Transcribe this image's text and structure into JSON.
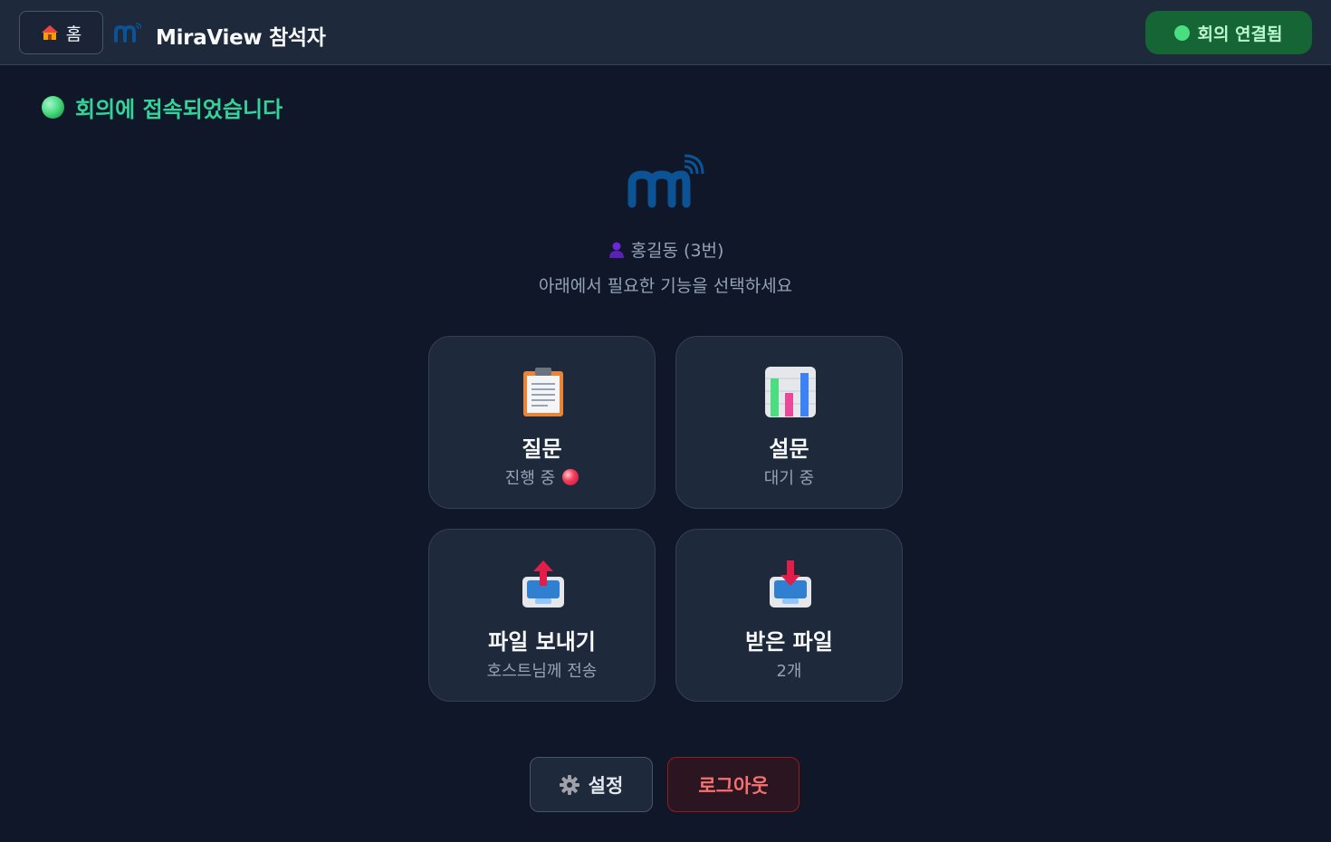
{
  "header": {
    "home_label": "홈",
    "app_title": "MiraView 참석자",
    "status_label": "회의 연결됨"
  },
  "connection": {
    "message": "회의에 접속되었습니다"
  },
  "user": {
    "name": "홍길동 (3번)",
    "instruction": "아래에서 필요한 기능을 선택하세요"
  },
  "cards": [
    {
      "icon": "clipboard-icon",
      "title": "질문",
      "subtitle": "진행 중",
      "indicator": "red-dot-icon"
    },
    {
      "icon": "bar-chart-icon",
      "title": "설문",
      "subtitle": "대기 중"
    },
    {
      "icon": "outbox-tray-icon",
      "title": "파일 보내기",
      "subtitle": "호스트님께 전송"
    },
    {
      "icon": "inbox-tray-icon",
      "title": "받은 파일",
      "subtitle": "2개"
    }
  ],
  "actions": {
    "settings_label": "설정",
    "logout_label": "로그아웃"
  },
  "colors": {
    "background": "#0f1729",
    "topbar": "#1e293b",
    "accent_green": "#34d399",
    "status_pill": "#166534",
    "logout_red": "#f87171",
    "brand_blue": "#0b5394"
  }
}
